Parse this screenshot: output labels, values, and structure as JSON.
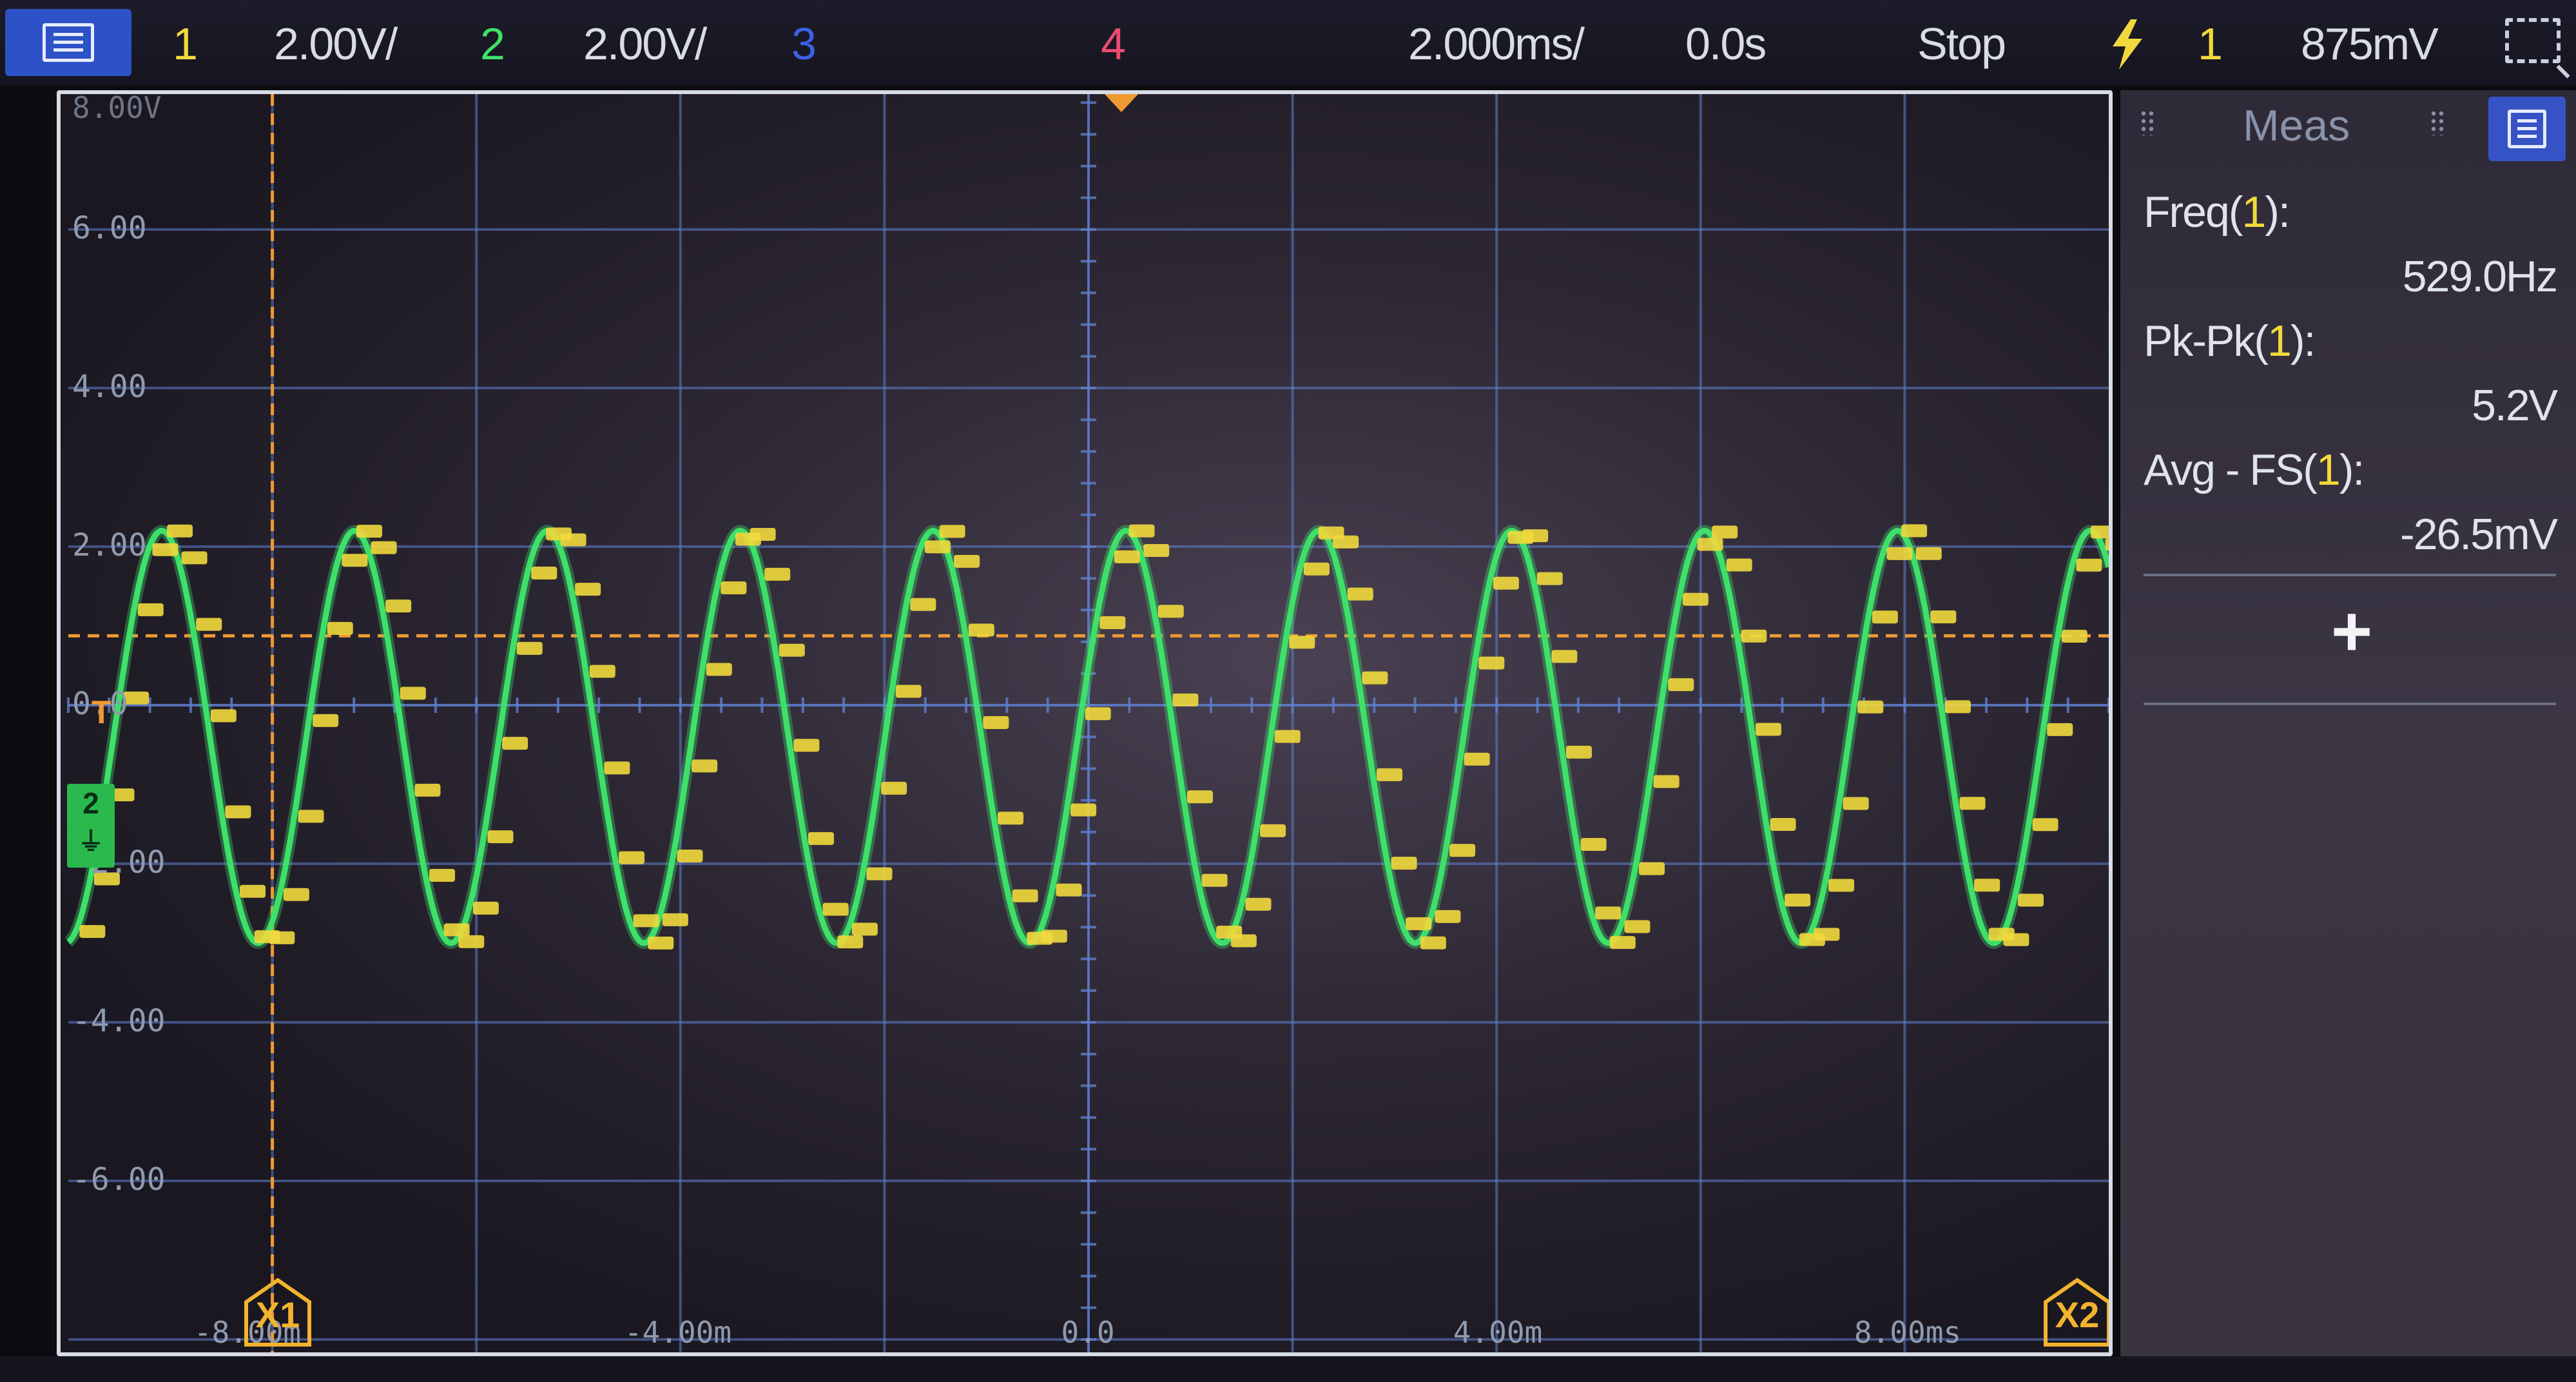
{
  "topbar": {
    "ch1": {
      "label": "1",
      "scale": "2.00V/"
    },
    "ch2": {
      "label": "2",
      "scale": "2.00V/"
    },
    "ch3": {
      "label": "3"
    },
    "ch4": {
      "label": "4"
    },
    "timebase": "2.000ms/",
    "delay": "0.0s",
    "run_state": "Stop",
    "trigger_source": "1",
    "trigger_level": "875mV"
  },
  "scope": {
    "ytop_label": "8.00V",
    "y_labels": [
      "6.00",
      "4.00",
      "2.00",
      "0.0",
      "-2.00",
      "-4.00",
      "-6.00"
    ],
    "x_labels": [
      "-8.00m",
      "-4.00m",
      "0.0",
      "4.00m",
      "8.00ms"
    ],
    "trigger_marker": "T",
    "ch2_marker": "2",
    "cursor1": "X1",
    "cursor2": "X2"
  },
  "measurements": {
    "title": "Meas",
    "items": [
      {
        "label_prefix": "Freq(",
        "source": "1",
        "label_suffix": "):",
        "value": "529.0Hz"
      },
      {
        "label_prefix": "Pk-Pk(",
        "source": "1",
        "label_suffix": "):",
        "value": "5.2V"
      },
      {
        "label_prefix": "Avg - FS(",
        "source": "1",
        "label_suffix": "):",
        "value": "-26.5mV"
      }
    ],
    "add_label": "+"
  },
  "colors": {
    "ch1": "#f1d93c",
    "ch2": "#3ee06a",
    "ch3": "#3b62e6",
    "ch4": "#ee4b6e",
    "trigger": "#f09a33",
    "grid": "#5f7fd0"
  },
  "signal": {
    "frequency_hz": 529.0,
    "peak_to_peak_v": 5.2,
    "offset_v": -0.4,
    "volts_per_div": 2.0,
    "time_per_div_ms": 2.0,
    "trigger_level_v": 0.875,
    "cursor_x1_ms": -8.0
  }
}
